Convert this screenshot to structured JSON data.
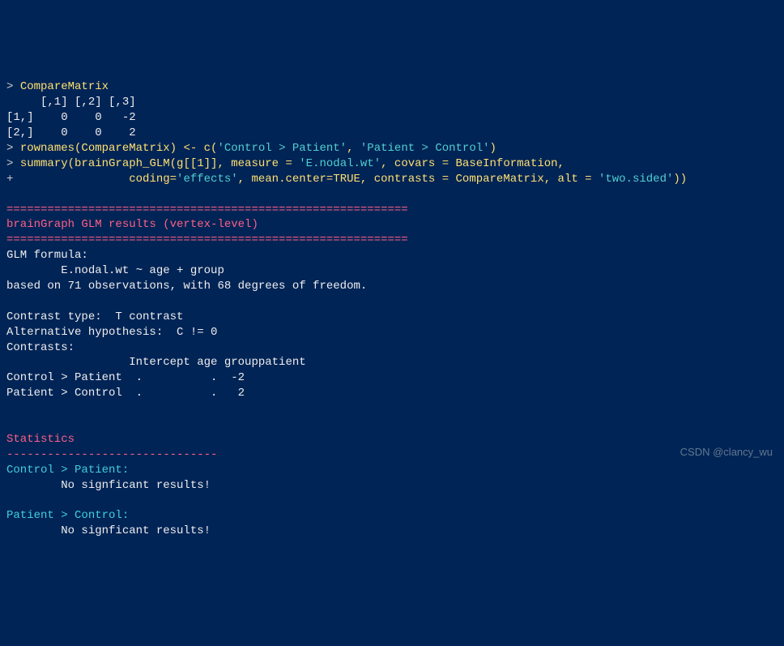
{
  "line1_prefix": "> ",
  "line1_cmd": "CompareMatrix",
  "matrix_header": "     [,1] [,2] [,3]",
  "matrix_row1": "[1,]    0    0   -2",
  "matrix_row2": "[2,]    0    0    2",
  "line_rownames_prefix": "> ",
  "line_rownames_cmd": "rownames(CompareMatrix) <- c(",
  "line_rownames_str1": "'Control > Patient'",
  "line_rownames_sep": ", ",
  "line_rownames_str2": "'Patient > Control'",
  "line_rownames_close": ")",
  "line_summary_prefix": "> ",
  "line_summary_cmd1": "summary(brainGraph_GLM(g[[1]], measure = ",
  "line_summary_str1": "'E.nodal.wt'",
  "line_summary_cmd2": ", covars = BaseInformation,",
  "line_cont_prefix": "+                 ",
  "line_cont_cmd1": "coding=",
  "line_cont_str1": "'effects'",
  "line_cont_cmd2": ", mean.center=TRUE, contrasts = CompareMatrix, alt = ",
  "line_cont_str2": "'two.sided'",
  "line_cont_close": "))",
  "separator": "===========================================================",
  "results_title": "brainGraph GLM results (vertex-level)",
  "glm_formula_label": "GLM formula:",
  "glm_formula": "        E.nodal.wt ~ age + group",
  "obs_line": "based on 71 observations, with 68 degrees of freedom.",
  "contrast_type": "Contrast type:  T contrast",
  "alt_hypothesis": "Alternative hypothesis:  C != 0",
  "contrasts_label": "Contrasts:",
  "contrasts_header": "                  Intercept age grouppatient",
  "contrasts_row1": "Control > Patient  .          .  -2",
  "contrasts_row2": "Patient > Control  .          .   2",
  "statistics_label": "Statistics",
  "stats_divider": "-------------------------------",
  "stat1_name": "Control > Patient:",
  "stat1_result": "        No signficant results!",
  "stat2_name": "Patient > Control:",
  "stat2_result": "        No signficant results!",
  "watermark": "CSDN @clancy_wu"
}
